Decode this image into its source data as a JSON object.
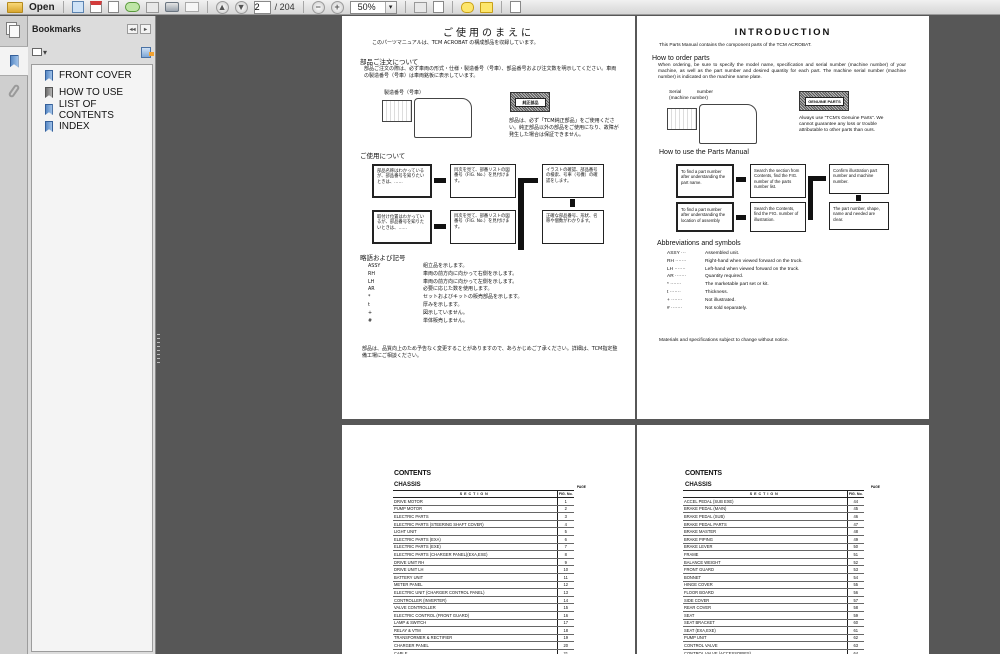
{
  "toolbar": {
    "open_label": "Open",
    "current_page": "2",
    "total_pages": "/ 204",
    "zoom_value": "50%",
    "icons": [
      "folder-open-icon",
      "create-pdf-icon",
      "combine-files-icon",
      "sign-icon",
      "cloud-upload-icon",
      "save-icon",
      "print-icon",
      "email-icon",
      "previous-page-icon",
      "next-page-icon",
      "zoom-out-icon",
      "zoom-in-icon",
      "zoom-dropdown-icon",
      "fit-page-icon",
      "fit-width-icon",
      "comment-icon",
      "highlight-icon",
      "fullscreen-icon"
    ]
  },
  "nav_panel": {
    "tabs": [
      {
        "name": "page-thumbnails",
        "active": false
      },
      {
        "name": "bookmarks",
        "active": true
      },
      {
        "name": "attachments",
        "active": false
      }
    ]
  },
  "bookmarks": {
    "title": "Bookmarks",
    "collapse_label": "◂◂",
    "expand_label": "▸",
    "items": [
      {
        "label": "FRONT COVER"
      },
      {
        "label": "HOW TO USE"
      },
      {
        "label": "LIST OF CONTENTS"
      },
      {
        "label": "INDEX"
      }
    ]
  },
  "page_jp": {
    "title": "ご使用のまえに",
    "intro": "このパーツマニュアルは、TCM ACROBAT の構成部品を収録しています。",
    "order_heading": "部品ご注文について",
    "order_text": "部品ご注文の際は、必ず車両の形式・仕様・製造番号（号車）、部品番号および注文数を明示してください。車両の製造番号（号車）は車両銘板に表示しています。",
    "serial_label": "製造番号（号車）",
    "genuine_label": "純正部品",
    "genuine_text": "部品は、必ず「TCM純正部品」をご使用ください。純正部品以外の部品をご使用になり、故障が発生した場合は保証できません。",
    "usage_heading": "ご使用について",
    "flow": [
      "部品名称はわかっているが、部品番号を知りたいときは、……",
      "目次を見て、部番リストの図番号（FIG. No.）を見付けます。",
      "イラストの確認、部品番号の検索、号車（号機）の確認をします。",
      "取付け位置はわかっているが、部品番号を知りたいときは、……",
      "目次を見て、部番リストの図番号（FIG. No.）を見付けます。",
      "正確な部品番号、形状、名称や個数がわかります。"
    ],
    "abbr_heading": "略語および記号",
    "abbreviations": [
      {
        "key": "ASSY",
        "desc": "組立品を示します。"
      },
      {
        "key": "RH",
        "desc": "車両の前方向に向かって右側を示します。"
      },
      {
        "key": "LH",
        "desc": "車両の前方向に向かって左側を示します。"
      },
      {
        "key": "AR",
        "desc": "必要に応じた数を使用します。"
      },
      {
        "key": "*",
        "desc": "セットおよびキットの販売部品を示します。"
      },
      {
        "key": "t",
        "desc": "厚みを示します。"
      },
      {
        "key": "+",
        "desc": "図示していません。"
      },
      {
        "key": "#",
        "desc": "単体販売しません。"
      }
    ],
    "footer": "部品は、品質向上のため予告なく変更することがありますので、あらかじめご了承ください。詳細は、TCM指定整備工場にご相談ください。"
  },
  "page_en": {
    "title": "INTRODUCTION",
    "intro": "This Parts Manual contains the component parts of the TCM ACROBAT.",
    "order_heading": "How to order parts",
    "order_text": "When ordering, be sure to specify the model name, specification and serial number (machine number) of your machine, as well as the part number and desired quantity for each part. The machine serial number (machine number) is indicated on the machine name plate.",
    "serial_label": "Serial number (machine number)",
    "genuine_label": "GENUINE PARTS",
    "genuine_text": "Always use \"TCM's Genuine Parts\". We cannot guarantee any loss or trouble attributable to other parts than ours.",
    "usage_heading": "How to use the Parts Manual",
    "flow": [
      "To find a part number after understanding the part name.",
      "Search the section from Contents, find the FIG. number of the parts number list.",
      "Confirm illustration part number and machine number.",
      "To find a part number after understanding the location of assembly",
      "Search the Contents, find the FIG. number of illustration.",
      "The part number, shape, name and needed are clear."
    ],
    "abbr_heading": "Abbreviations and symbols",
    "abbreviations": [
      {
        "key": "ASSY ···",
        "desc": "Assembled unit."
      },
      {
        "key": "RH ·······",
        "desc": "Right-hand when viewed forward on the truck."
      },
      {
        "key": "LH ·······",
        "desc": "Left-hand when viewed forward on the truck."
      },
      {
        "key": "AR ·······",
        "desc": "Quantity required."
      },
      {
        "key": "* ·······",
        "desc": "The marketable part set or kit."
      },
      {
        "key": "t ·······",
        "desc": "Thickness."
      },
      {
        "key": "+ ·······",
        "desc": "Not illustrated."
      },
      {
        "key": "# ·······",
        "desc": "Not sold separately."
      }
    ],
    "footer": "Materials and specifications subject to change without notice."
  },
  "contents_left": {
    "title": "CONTENTS",
    "subtitle": "CHASSIS",
    "page_label": "PAGE",
    "col_section": "SECTION",
    "col_fig": "FIG. No.",
    "rows": [
      {
        "section": "DRIVE MOTOR",
        "fig": "1"
      },
      {
        "section": "PUMP MOTOR",
        "fig": "2"
      },
      {
        "section": "ELECTRIC PARTS",
        "fig": "3"
      },
      {
        "section": "ELECTRIC PARTS (STEERING SHAFT COVER)",
        "fig": "4"
      },
      {
        "section": "LIGHT UNIT",
        "fig": "5"
      },
      {
        "section": "ELECTRIC PARTS (EXA)",
        "fig": "6"
      },
      {
        "section": "ELECTRIC PARTS (EXE)",
        "fig": "7"
      },
      {
        "section": "ELECTRIC PARTS (CHARGER PANEL)(EXA,EXE)",
        "fig": "8"
      },
      {
        "section": "DRIVE UNIT RH",
        "fig": "9"
      },
      {
        "section": "DRIVE UNIT LH",
        "fig": "10"
      },
      {
        "section": "BATTERY UNIT",
        "fig": "11"
      },
      {
        "section": "METER PANEL",
        "fig": "12"
      },
      {
        "section": "ELECTRIC UNIT (CHARGER CONTROL PANEL)",
        "fig": "13"
      },
      {
        "section": "CONTROLLER (INVERTER)",
        "fig": "14"
      },
      {
        "section": "VALVE CONTROLLER",
        "fig": "15"
      },
      {
        "section": "ELECTRIC CONTROL (FRONT GUARD)",
        "fig": "16"
      },
      {
        "section": "LAMP & SWITCH",
        "fig": "17"
      },
      {
        "section": "RELAY & VTM",
        "fig": "18"
      },
      {
        "section": "TRANSFORMER & RECTIFIER",
        "fig": "19"
      },
      {
        "section": "CHARGER PANEL",
        "fig": "20"
      },
      {
        "section": "CABLE",
        "fig": "21"
      }
    ]
  },
  "contents_right": {
    "title": "CONTENTS",
    "subtitle": "CHASSIS",
    "page_label": "PAGE",
    "col_section": "SECTION",
    "col_fig": "FIG. No.",
    "rows": [
      {
        "section": "ACCEL PEDAL (SUB EXE)",
        "fig": "44"
      },
      {
        "section": "BRAKE PEDAL (MAIN)",
        "fig": "45"
      },
      {
        "section": "BRAKE PEDAL (SUB)",
        "fig": "46"
      },
      {
        "section": "BRAKE PEDAL PARTS",
        "fig": "47"
      },
      {
        "section": "BRAKE MASTER",
        "fig": "48"
      },
      {
        "section": "BRAKE PIPING",
        "fig": "49"
      },
      {
        "section": "BRAKE LEVER",
        "fig": "50"
      },
      {
        "section": "FRAME",
        "fig": "51"
      },
      {
        "section": "BALANCE WEIGHT",
        "fig": "52"
      },
      {
        "section": "FRONT GUARD",
        "fig": "53"
      },
      {
        "section": "BONNET",
        "fig": "54"
      },
      {
        "section": "HINGE COVER",
        "fig": "55"
      },
      {
        "section": "FLOOR BOARD",
        "fig": "56"
      },
      {
        "section": "SIDE COVER",
        "fig": "57"
      },
      {
        "section": "REAR COVER",
        "fig": "58"
      },
      {
        "section": "SEAT",
        "fig": "59"
      },
      {
        "section": "SEAT BRACKET",
        "fig": "60"
      },
      {
        "section": "SEAT (EXA,EXE)",
        "fig": "61"
      },
      {
        "section": "PUMP UNIT",
        "fig": "62"
      },
      {
        "section": "CONTROL VALVE",
        "fig": "63"
      },
      {
        "section": "CONTROL VALVE (ACCESSORIES)",
        "fig": "64"
      }
    ]
  }
}
